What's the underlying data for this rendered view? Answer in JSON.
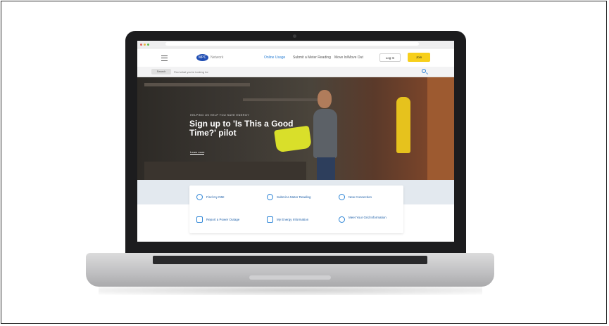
{
  "site": {
    "logo_text": "MPC",
    "brand_text": "Network"
  },
  "nav": {
    "links": [
      "Online Usage",
      "Submit a Meter Reading",
      "Move In/Move Out"
    ],
    "login_label": "Log In",
    "join_label": "Join"
  },
  "search": {
    "scope": "Search",
    "placeholder": "Find what you're looking for"
  },
  "hero": {
    "eyebrow": "HELPING US HELP YOU SAVE ENERGY",
    "title": "Sign up to 'Is This a Good Time?' pilot",
    "link_label": "Learn more"
  },
  "quick_links": [
    {
      "label": "Find my NMI",
      "icon": "search-icon"
    },
    {
      "label": "Submit a Meter Reading",
      "icon": "meter-icon"
    },
    {
      "label": "New Connection",
      "icon": "globe-icon"
    },
    {
      "label": "Report a Power Outage",
      "icon": "warning-icon"
    },
    {
      "label": "My Energy Information",
      "icon": "chart-icon"
    },
    {
      "label": "Meet Your Grid Information",
      "icon": "grid-icon"
    }
  ],
  "colors": {
    "accent_blue": "#2a7fd4",
    "brand_navy": "#1f4db3",
    "join_yellow": "#f7cf1b"
  }
}
